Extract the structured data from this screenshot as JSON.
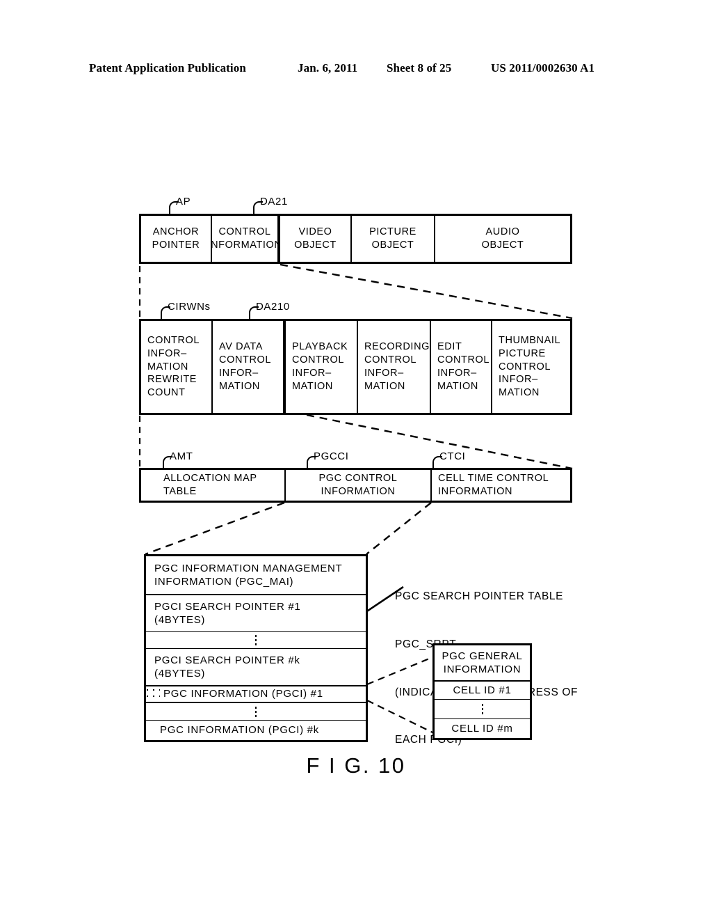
{
  "header": {
    "publication": "Patent Application Publication",
    "date": "Jan. 6, 2011",
    "sheet": "Sheet 8 of 25",
    "number": "US 2011/0002630 A1"
  },
  "figure": {
    "caption": "F I G. 10"
  },
  "row1": {
    "labels": [
      {
        "text": "AP"
      },
      {
        "text": "DA21"
      }
    ],
    "cells": [
      {
        "lines": [
          "ANCHOR",
          "POINTER"
        ]
      },
      {
        "lines": [
          "CONTROL",
          "INFORMATION"
        ]
      },
      {
        "lines": [
          "VIDEO",
          "OBJECT"
        ]
      },
      {
        "lines": [
          "PICTURE",
          "OBJECT"
        ]
      },
      {
        "lines": [
          "AUDIO",
          "OBJECT"
        ]
      }
    ]
  },
  "row2": {
    "labels": [
      {
        "text": "CIRWNs"
      },
      {
        "text": "DA210"
      }
    ],
    "cells": [
      {
        "lines": [
          "CONTROL",
          "INFOR–",
          "MATION",
          "REWRITE",
          "COUNT"
        ]
      },
      {
        "lines": [
          "AV DATA",
          "CONTROL",
          "INFOR–",
          "MATION"
        ]
      },
      {
        "lines": [
          "PLAYBACK",
          "CONTROL",
          "INFOR–",
          "MATION"
        ]
      },
      {
        "lines": [
          "RECORDING",
          "CONTROL",
          "INFOR–",
          "MATION"
        ]
      },
      {
        "lines": [
          "EDIT",
          "CONTROL",
          "INFOR–",
          "MATION"
        ]
      },
      {
        "lines": [
          "THUMBNAIL",
          "PICTURE",
          "CONTROL",
          "INFOR–",
          "MATION"
        ]
      }
    ]
  },
  "row3": {
    "labels": [
      {
        "text": "AMT"
      },
      {
        "text": "PGCCI"
      },
      {
        "text": "CTCI"
      }
    ],
    "cells": [
      {
        "lines": [
          "ALLOCATION MAP",
          "TABLE"
        ]
      },
      {
        "lines": [
          "PGC CONTROL",
          "INFORMATION"
        ]
      },
      {
        "lines": [
          "CELL TIME CONTROL",
          "INFORMATION"
        ]
      }
    ]
  },
  "pgc_table": {
    "rows": [
      {
        "type": "text",
        "lines": [
          "PGC INFORMATION MANAGEMENT",
          "INFORMATION (PGC_MAI)"
        ]
      },
      {
        "type": "text",
        "lines": [
          "PGCI SEARCH POINTER #1",
          "(4BYTES)"
        ]
      },
      {
        "type": "ellipsis",
        "lines": []
      },
      {
        "type": "text",
        "lines": [
          "PGCI SEARCH POINTER #k",
          "(4BYTES)"
        ]
      },
      {
        "type": "stipple",
        "lines": [
          "PGC INFORMATION (PGCI) #1"
        ]
      },
      {
        "type": "ellipsis",
        "lines": []
      },
      {
        "type": "text",
        "lines": [
          "PGC INFORMATION (PGCI) #k"
        ]
      }
    ]
  },
  "annotation": {
    "lines": [
      "PGC SEARCH POINTER TABLE",
      "PGC_SRPT",
      "(INDICATING STARTADDRESS OF",
      "EACH PGCI)"
    ]
  },
  "cell_table": {
    "rows": [
      {
        "type": "text",
        "lines": [
          "PGC GENERAL",
          "INFORMATION"
        ]
      },
      {
        "type": "text",
        "lines": [
          "CELL ID #1"
        ]
      },
      {
        "type": "ellipsis",
        "lines": []
      },
      {
        "type": "text",
        "lines": [
          "CELL ID #m"
        ]
      }
    ]
  },
  "colors": {
    "ink": "#000000",
    "paper": "#ffffff"
  }
}
